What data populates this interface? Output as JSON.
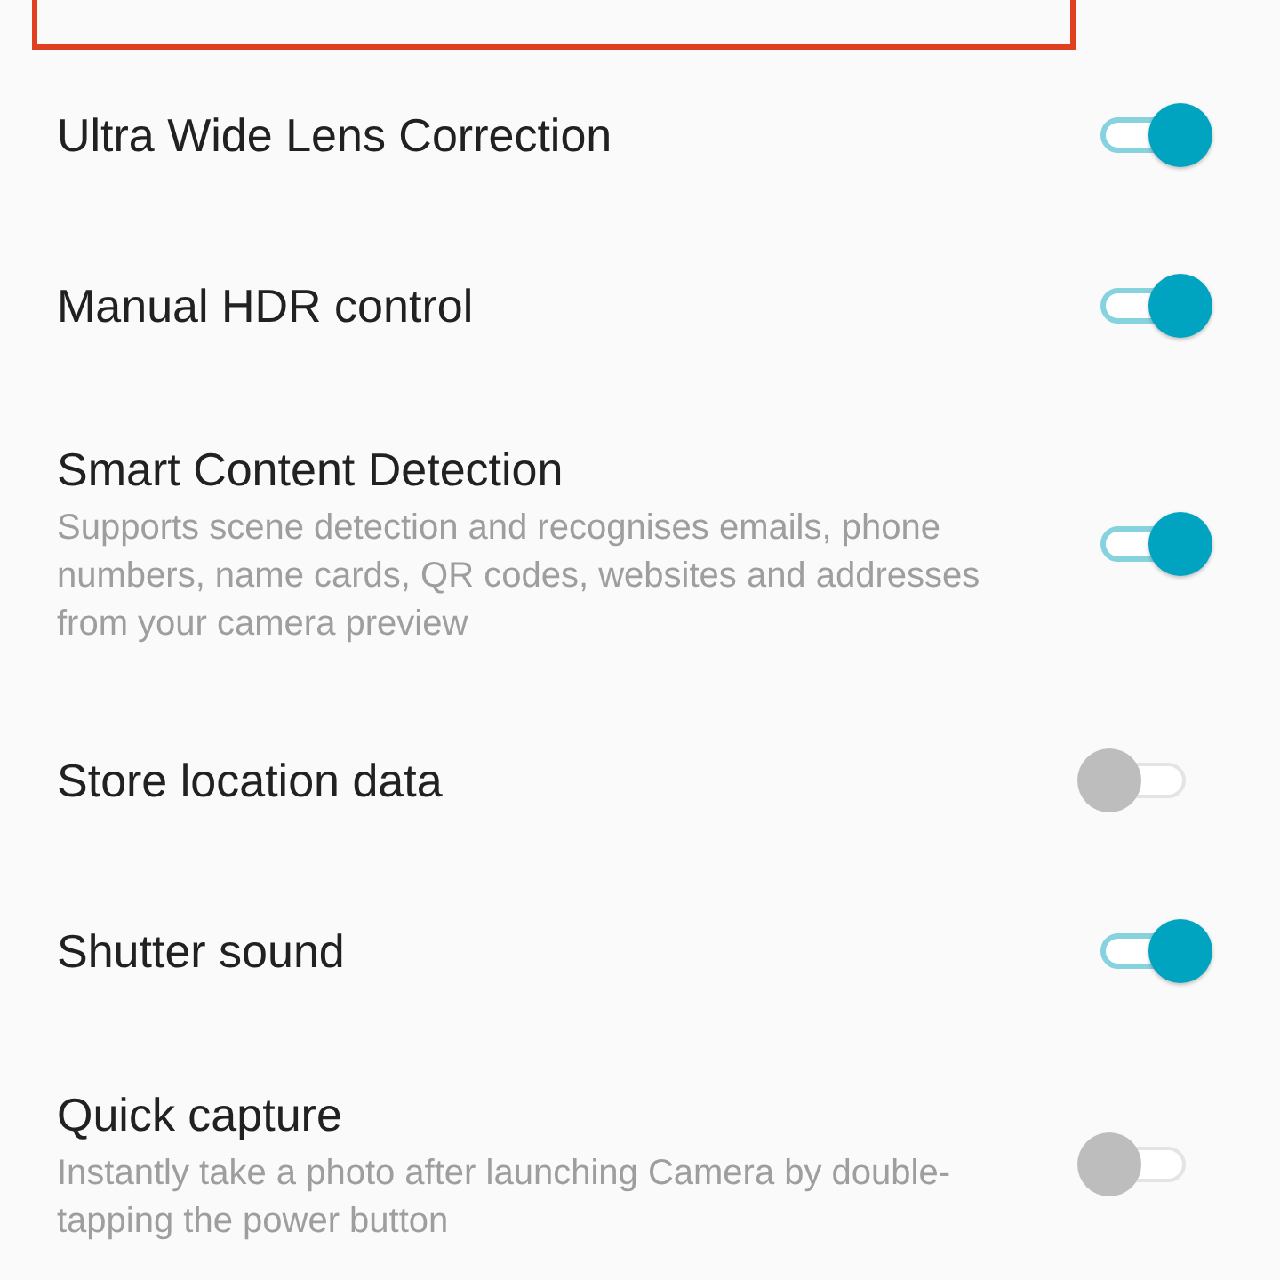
{
  "settings": [
    {
      "title": "Ultra Wide Lens Correction",
      "on": true
    },
    {
      "title": "Manual HDR control",
      "on": true
    },
    {
      "title": "Smart Content Detection",
      "description": "Supports scene detection and recognises emails, phone numbers, name cards, QR codes, websites and addresses from your camera preview",
      "on": true
    },
    {
      "title": "Store location data",
      "on": false
    },
    {
      "title": "Shutter sound",
      "on": true
    },
    {
      "title": "Quick capture",
      "description": "Instantly take a photo after launching Camera by double-tapping the power button",
      "on": false
    }
  ]
}
